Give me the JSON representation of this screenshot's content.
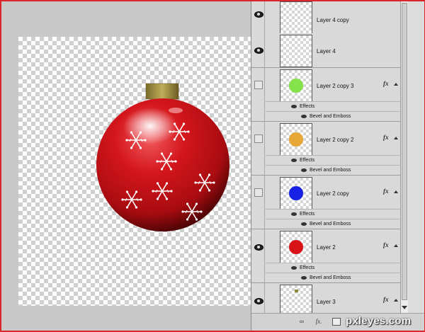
{
  "canvas": {
    "ornament_color": "#c8141a",
    "cap_color": "#9a8a3c",
    "snowflakes": 7
  },
  "layers_panel": {
    "layers": [
      {
        "name": "Layer 4 copy",
        "visible": true,
        "thumb": "blank"
      },
      {
        "name": "Layer 4",
        "visible": true,
        "thumb": "blank"
      },
      {
        "name": "Layer 2 copy 3",
        "visible": false,
        "thumb": "#84e24a",
        "fx": "fx",
        "effects_label": "Effects",
        "effect": "Bevel and Emboss"
      },
      {
        "name": "Layer 2 copy 2",
        "visible": false,
        "thumb": "#e8a838",
        "fx": "fx",
        "effects_label": "Effects",
        "effect": "Bevel and Emboss"
      },
      {
        "name": "Layer 2 copy",
        "visible": false,
        "thumb": "#1822e6",
        "fx": "fx",
        "effects_label": "Effects",
        "effect": "Bevel and Emboss"
      },
      {
        "name": "Layer 2",
        "visible": true,
        "thumb": "#d81418",
        "fx": "fx",
        "effects_label": "Effects",
        "effect": "Bevel and Emboss"
      },
      {
        "name": "Layer 3",
        "visible": true,
        "thumb": "cap",
        "fx": "fx"
      }
    ],
    "footer": {
      "link_icon": "link-icon",
      "fx_label": "fx.",
      "mask_icon": "mask-icon"
    }
  },
  "watermark": "pxleyes.com"
}
